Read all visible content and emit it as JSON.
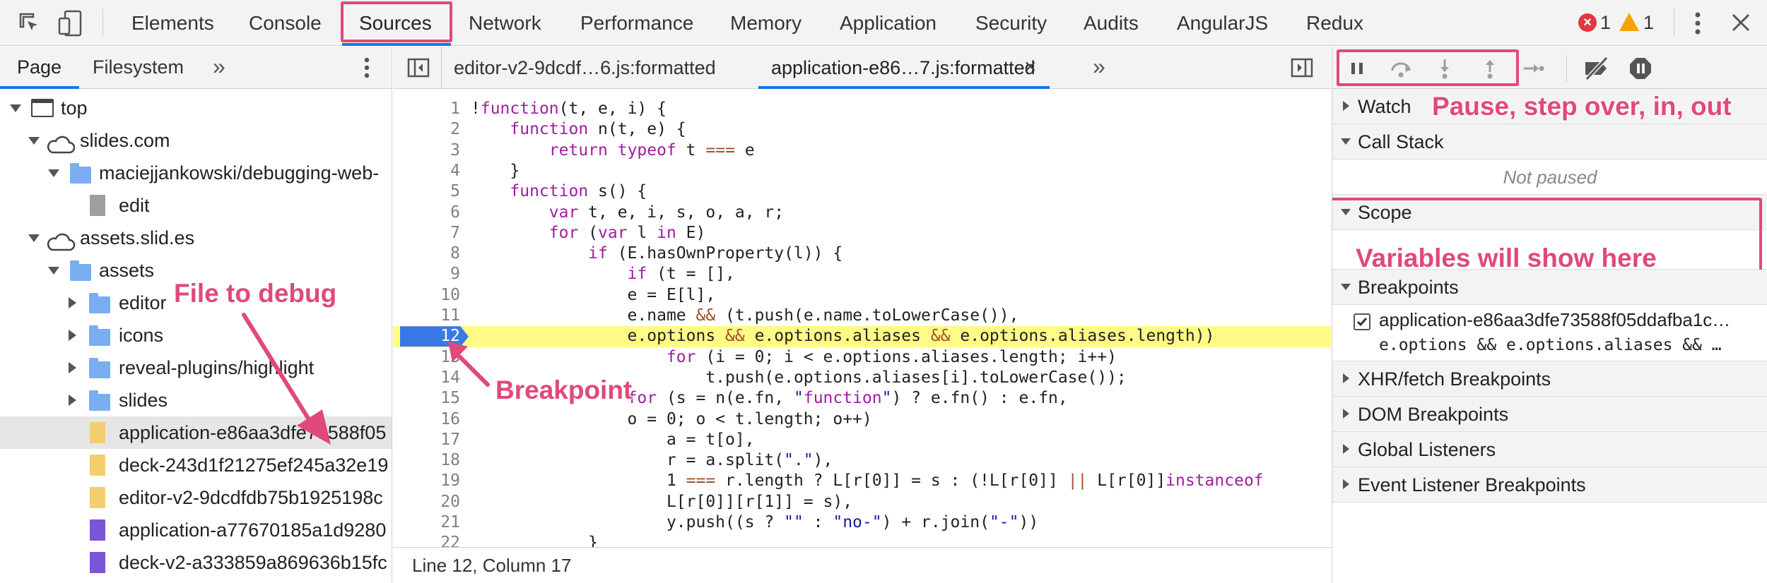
{
  "toolbar": {
    "tabs": [
      "Elements",
      "Console",
      "Sources",
      "Network",
      "Performance",
      "Memory",
      "Application",
      "Security",
      "Audits",
      "AngularJS",
      "Redux"
    ],
    "active_tab": "Sources",
    "error_count": "1",
    "warning_count": "1"
  },
  "navigator": {
    "tabs": [
      "Page",
      "Filesystem"
    ],
    "more": "»",
    "tree": [
      {
        "label": "top",
        "type": "frame"
      },
      {
        "label": "slides.com",
        "type": "cloud"
      },
      {
        "label": "maciejjankowski/debugging-web-",
        "type": "folder"
      },
      {
        "label": "edit",
        "type": "file"
      },
      {
        "label": "assets.slid.es",
        "type": "cloud"
      },
      {
        "label": "assets",
        "type": "folder"
      },
      {
        "label": "editor",
        "type": "folder"
      },
      {
        "label": "icons",
        "type": "folder"
      },
      {
        "label": "reveal-plugins/highlight",
        "type": "folder"
      },
      {
        "label": "slides",
        "type": "folder"
      },
      {
        "label": "application-e86aa3dfe73588f05",
        "type": "js"
      },
      {
        "label": "deck-243d1f21275ef245a32e19",
        "type": "js"
      },
      {
        "label": "editor-v2-9dcdfdb75b1925198c",
        "type": "js"
      },
      {
        "label": "application-a77670185a1d9280",
        "type": "css"
      },
      {
        "label": "deck-v2-a333859a869636b15fc",
        "type": "css"
      }
    ]
  },
  "editor": {
    "tabs": [
      {
        "label": "editor-v2-9dcdf…6.js:formatted"
      },
      {
        "label": "application-e86…7.js:formatted",
        "close": "×"
      }
    ],
    "more": "»",
    "breakpoint_line": "12",
    "lines": [
      "!function(t, e, i) {",
      "    function n(t, e) {",
      "        return typeof t === e",
      "    }",
      "    function s() {",
      "        var t, e, i, s, o, a, r;",
      "        for (var l in E)",
      "            if (E.hasOwnProperty(l)) {",
      "                if (t = [],",
      "                e = E[l],",
      "                e.name && (t.push(e.name.toLowerCase()),",
      "                e.options && e.options.aliases && e.options.aliases.length))",
      "                    for (i = 0; i < e.options.aliases.length; i++)",
      "                        t.push(e.options.aliases[i].toLowerCase());",
      "                for (s = n(e.fn, \"function\") ? e.fn() : e.fn,",
      "                o = 0; o < t.length; o++)",
      "                    a = t[o],",
      "                    r = a.split(\".\"),",
      "                    1 === r.length ? L[r[0]] = s : (!L[r[0]] || L[r[0]]instanceof",
      "                    L[r[0]][r[1]] = s),",
      "                    y.push((s ? \"\" : \"no-\") + r.join(\"-\"))",
      "            }"
    ],
    "status": "Line 12, Column 17"
  },
  "debugger": {
    "watch": "Watch",
    "call_stack": "Call Stack",
    "not_paused": "Not paused",
    "scope": "Scope",
    "breakpoints": "Breakpoints",
    "breakpoint_file": "application-e86aa3dfe73588f05ddafba1c…",
    "breakpoint_code": "e.options && e.options.aliases && …",
    "xhr": "XHR/fetch Breakpoints",
    "dom": "DOM Breakpoints",
    "global": "Global Listeners",
    "event": "Event Listener Breakpoints"
  },
  "annotations": {
    "controls": "Pause, step over, in, out",
    "variables": "Variables will show here",
    "file": "File to debug",
    "breakpoint": "Breakpoint"
  },
  "colors": {
    "accent": "#e0497a",
    "breakpoint": "#3b78e7",
    "highlight": "#fffb86"
  }
}
